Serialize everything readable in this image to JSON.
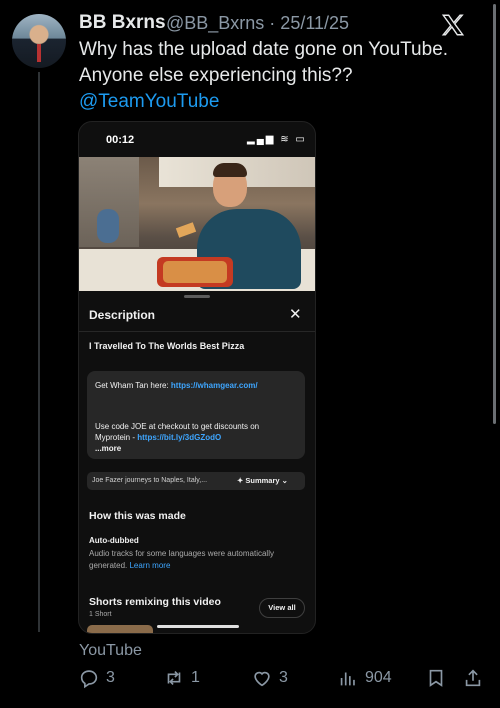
{
  "tweet": {
    "author_name": "BB Bxrns",
    "handle_date": "@BB_Bxrns · 25/11/25",
    "text_line1": "Why has the upload date gone on YouTube.",
    "text_line2": "Anyone else experiencing this??",
    "mention": "@TeamYouTube",
    "source": "YouTube"
  },
  "phone": {
    "time": "00:12",
    "status": "▂▄▆ ≋ ▭",
    "panel_title": "Description",
    "close_label": "✕",
    "video_title": "I Travelled To The Worlds Best Pizza",
    "description": {
      "line1_text": "Get Wham Tan here: ",
      "line1_link": "https://whamgear.com/",
      "line2_text": "Use code JOE at checkout to get discounts on",
      "line3_text": "Myprotein - ",
      "line3_link": "https://bit.ly/3dGZodO",
      "more": "...more"
    },
    "summary_snippet": "Joe Fazer journeys to Naples, Italy,...",
    "summary_button": "✦ Summary ⌄",
    "how_made_heading": "How this was made",
    "auto_dubbed_label": "Auto-dubbed",
    "auto_desc_line1": "Audio tracks for some languages were automatically",
    "auto_desc_line2": "generated. ",
    "learn_more": "Learn more",
    "shorts_heading": "Shorts remixing this video",
    "shorts_count": "1 Short",
    "view_all": "View all"
  },
  "actions": {
    "replies": "3",
    "reposts": "1",
    "likes": "3",
    "views": "904"
  },
  "icons": [
    "x-logo-icon",
    "reply-icon",
    "repost-icon",
    "like-icon",
    "views-icon",
    "bookmark-icon",
    "share-icon"
  ]
}
